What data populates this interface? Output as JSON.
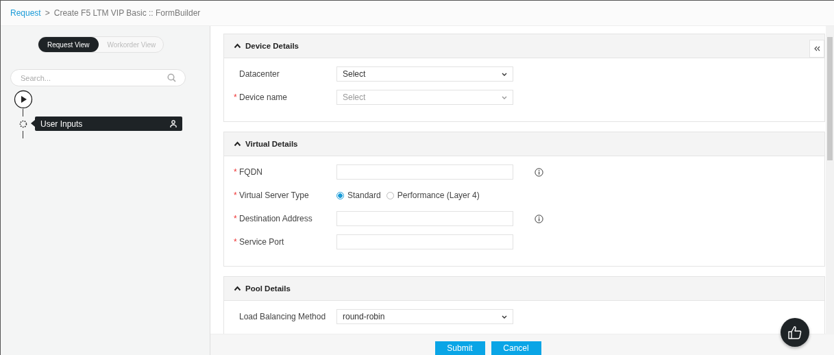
{
  "breadcrumb": {
    "link": "Request",
    "separator": ">",
    "title": "Create F5 LTM VIP Basic :: FormBuilder"
  },
  "view_toggle": [
    {
      "label": "Request View",
      "selected": true
    },
    {
      "label": "Workorder View",
      "selected": false
    }
  ],
  "search": {
    "placeholder": "Search..."
  },
  "workflow": [
    {
      "label": "User Inputs"
    }
  ],
  "sections": [
    {
      "title": "Device Details",
      "expanded": true,
      "fields": [
        {
          "kind": "select",
          "label": "Datacenter",
          "value": "Select",
          "disabled": false
        },
        {
          "kind": "select",
          "label": "Device name",
          "required_mark": "*",
          "value": "Select",
          "disabled": true
        }
      ]
    },
    {
      "title": "Virtual Details",
      "expanded": true,
      "fields": [
        {
          "kind": "text",
          "label": "FQDN",
          "required_mark": "*",
          "info": true
        },
        {
          "kind": "radio",
          "label": "Virtual Server Type",
          "required_mark": "*",
          "options": [
            {
              "label": "Standard",
              "selected": true
            },
            {
              "label": "Performance (Layer 4)",
              "selected": false
            }
          ]
        },
        {
          "kind": "text",
          "label": "Destination Address",
          "required_mark": "*",
          "info": true
        },
        {
          "kind": "text",
          "label": "Service Port",
          "required_mark": "*",
          "info": false
        }
      ]
    },
    {
      "title": "Pool Details",
      "expanded": true,
      "fields": [
        {
          "kind": "select",
          "label": "Load Balancing Method",
          "value": "round-robin",
          "disabled": false
        }
      ]
    }
  ],
  "buttons": [
    "Submit",
    "Cancel"
  ]
}
